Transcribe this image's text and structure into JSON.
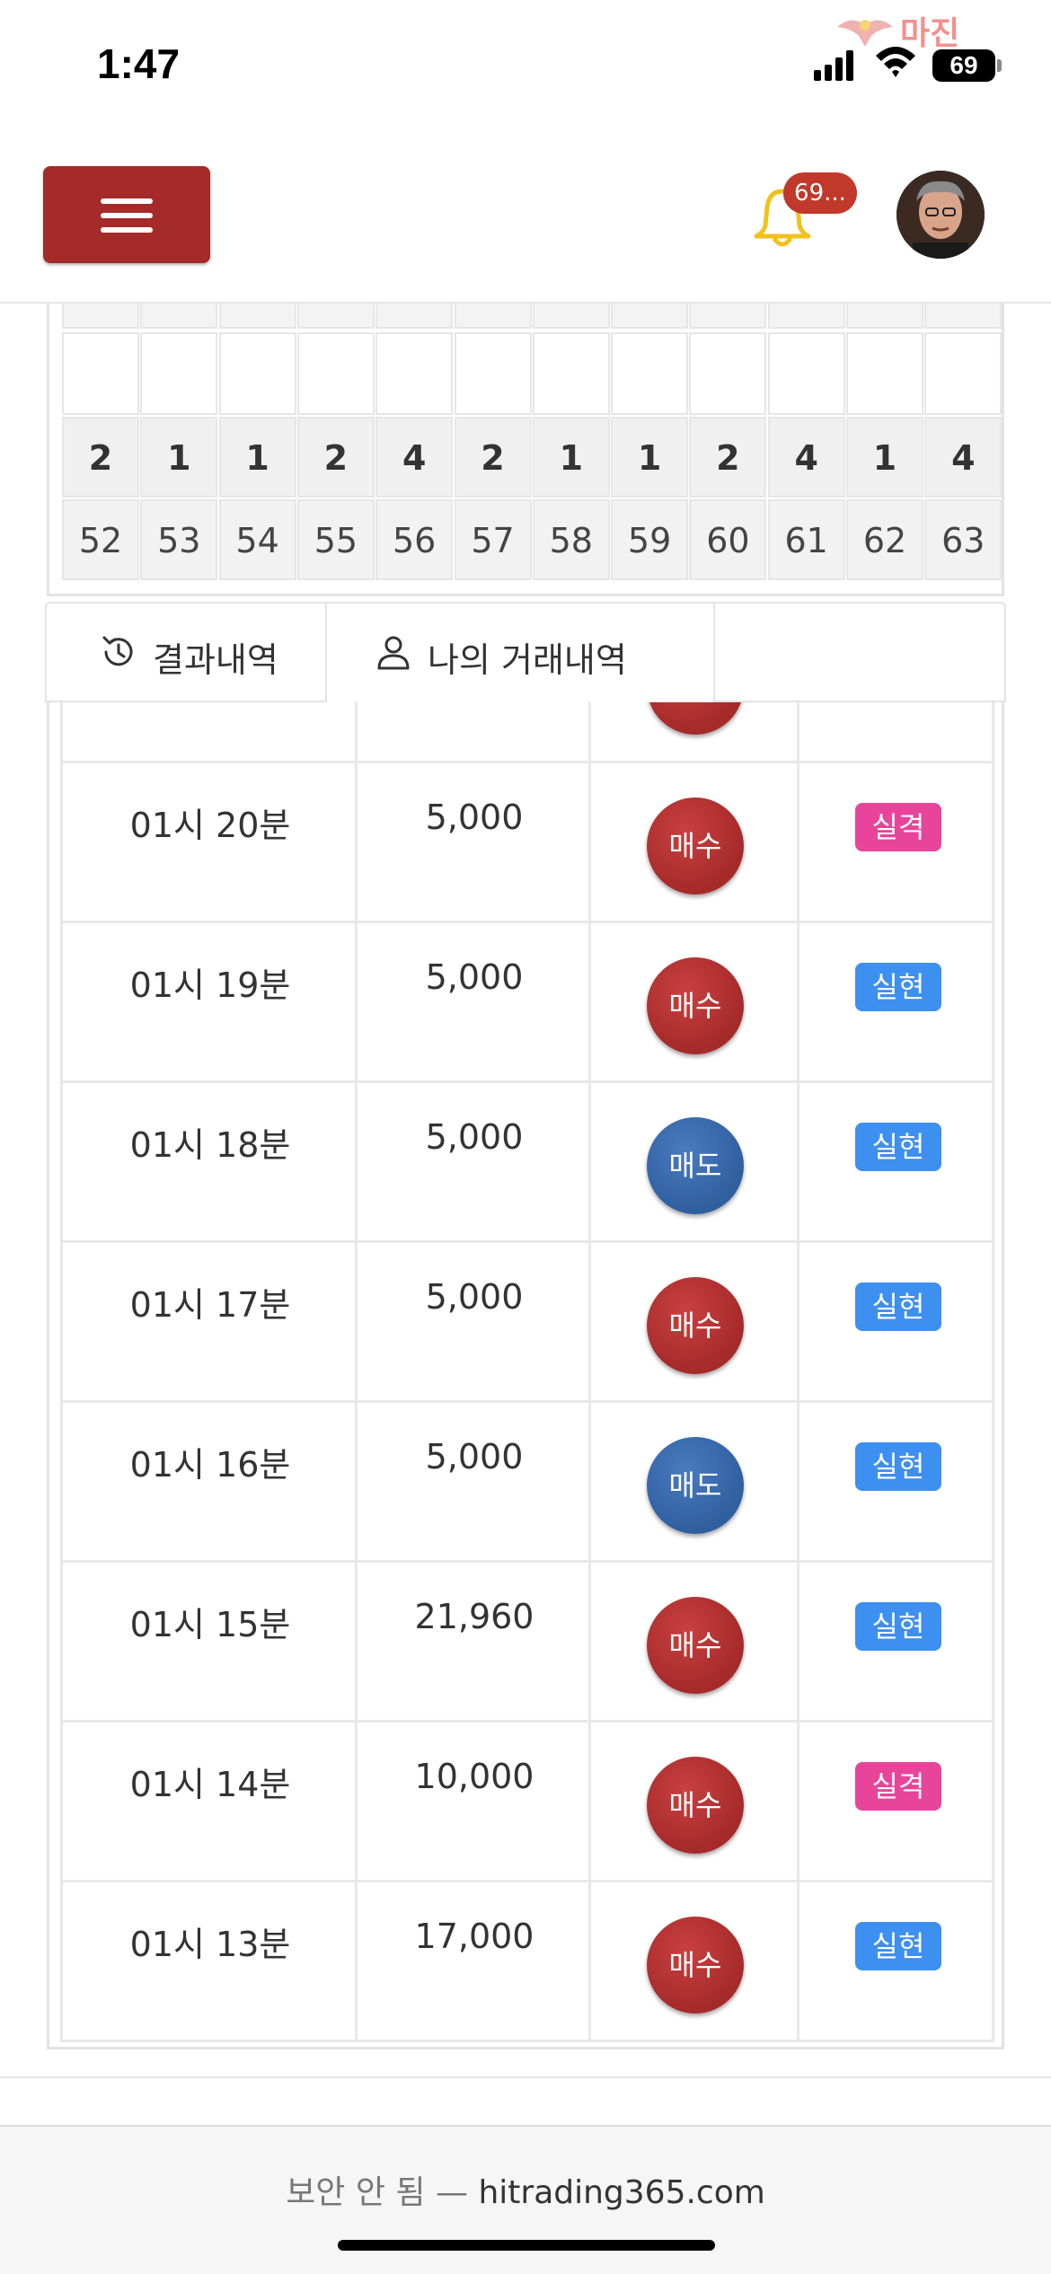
{
  "status_bar": {
    "time": "1:47",
    "battery": "69"
  },
  "watermark": {
    "text": "마진"
  },
  "header": {
    "notification_count": "69..."
  },
  "result_grid": {
    "values": [
      "2",
      "1",
      "1",
      "2",
      "4",
      "2",
      "1",
      "1",
      "2",
      "4",
      "1",
      "4"
    ],
    "numbers": [
      "52",
      "53",
      "54",
      "55",
      "56",
      "57",
      "58",
      "59",
      "60",
      "61",
      "62",
      "63"
    ]
  },
  "tabs": [
    {
      "label": "결과내역",
      "icon": "history-icon",
      "active": false
    },
    {
      "label": "나의 거래내역",
      "icon": "user-icon",
      "active": true
    }
  ],
  "trades": [
    {
      "time": "01시 20분",
      "amount": "5,000",
      "direction": "매수",
      "type": "buy",
      "result": "실격",
      "status": "fail"
    },
    {
      "time": "01시 19분",
      "amount": "5,000",
      "direction": "매수",
      "type": "buy",
      "result": "실현",
      "status": "win"
    },
    {
      "time": "01시 18분",
      "amount": "5,000",
      "direction": "매도",
      "type": "sell",
      "result": "실현",
      "status": "win"
    },
    {
      "time": "01시 17분",
      "amount": "5,000",
      "direction": "매수",
      "type": "buy",
      "result": "실현",
      "status": "win"
    },
    {
      "time": "01시 16분",
      "amount": "5,000",
      "direction": "매도",
      "type": "sell",
      "result": "실현",
      "status": "win"
    },
    {
      "time": "01시 15분",
      "amount": "21,960",
      "direction": "매수",
      "type": "buy",
      "result": "실현",
      "status": "win"
    },
    {
      "time": "01시 14분",
      "amount": "10,000",
      "direction": "매수",
      "type": "buy",
      "result": "실격",
      "status": "fail"
    },
    {
      "time": "01시 13분",
      "amount": "17,000",
      "direction": "매수",
      "type": "buy",
      "result": "실현",
      "status": "win"
    }
  ],
  "browser": {
    "security_label": "보안 안 됨 —",
    "domain": "hitrading365.com"
  },
  "colors": {
    "brand": "#a52a2a",
    "buy": "#b03535",
    "sell": "#3b6fb0",
    "fail": "#e8449a",
    "win": "#3d8ff0"
  }
}
